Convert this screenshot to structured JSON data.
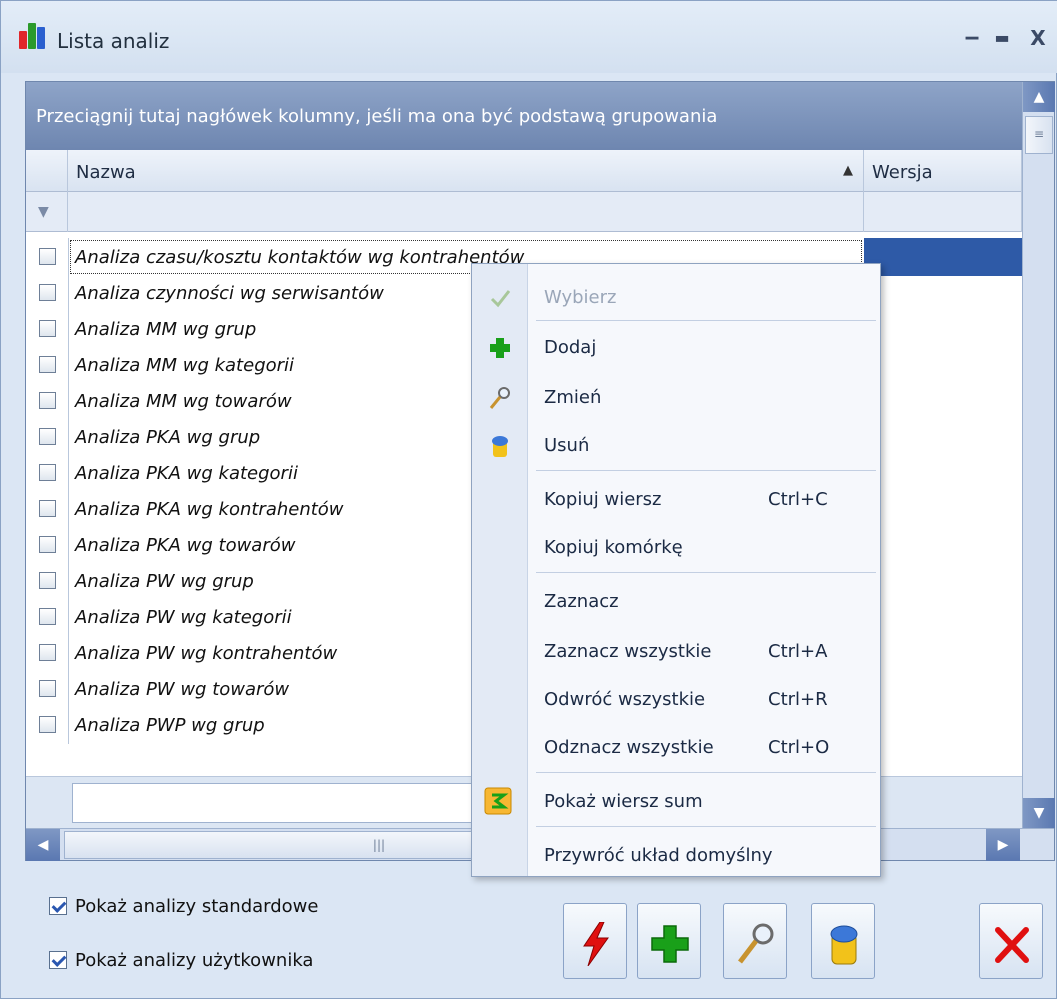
{
  "window": {
    "title": "Lista analiz",
    "min_label": "‒",
    "max_label": "▬",
    "close_label": "X"
  },
  "grid": {
    "group_panel_text": "Przeciągnij tutaj nagłówek kolumny, jeśli ma ona być podstawą grupowania",
    "columns": {
      "name": "Nazwa",
      "version": "Wersja"
    },
    "sort_indicator": "▲",
    "rows": [
      "Analiza czasu/kosztu kontaktów wg kontrahentów",
      "Analiza czynności wg serwisantów",
      "Analiza MM wg grup",
      "Analiza MM wg kategorii",
      "Analiza MM wg towarów",
      "Analiza PKA wg grup",
      "Analiza PKA wg kategorii",
      "Analiza PKA wg kontrahentów",
      "Analiza PKA wg towarów",
      "Analiza PW wg grup",
      "Analiza PW wg kategorii",
      "Analiza PW wg kontrahentów",
      "Analiza PW wg towarów",
      "Analiza PWP wg grup"
    ],
    "selected_row": 0
  },
  "context_menu": {
    "items": [
      {
        "label": "Wybierz",
        "shortcut": "",
        "icon": "check-icon",
        "disabled": true
      },
      {
        "label": "Dodaj",
        "shortcut": "",
        "icon": "plus-icon",
        "disabled": false
      },
      {
        "label": "Zmień",
        "shortcut": "",
        "icon": "magnifier-icon",
        "disabled": false
      },
      {
        "label": "Usuń",
        "shortcut": "",
        "icon": "trash-icon",
        "disabled": false
      },
      {
        "label": "Kopiuj wiersz",
        "shortcut": "Ctrl+C",
        "icon": "",
        "disabled": false
      },
      {
        "label": "Kopiuj komórkę",
        "shortcut": "",
        "icon": "",
        "disabled": false
      },
      {
        "label": "Zaznacz",
        "shortcut": "",
        "icon": "",
        "disabled": false
      },
      {
        "label": "Zaznacz wszystkie",
        "shortcut": "Ctrl+A",
        "icon": "",
        "disabled": false
      },
      {
        "label": "Odwróć wszystkie",
        "shortcut": "Ctrl+R",
        "icon": "",
        "disabled": false
      },
      {
        "label": "Odznacz wszystkie",
        "shortcut": "Ctrl+O",
        "icon": "",
        "disabled": false
      },
      {
        "label": "Pokaż wiersz sum",
        "shortcut": "",
        "icon": "sum-icon",
        "disabled": false
      },
      {
        "label": "Przywróć układ domyślny",
        "shortcut": "",
        "icon": "",
        "disabled": false
      }
    ]
  },
  "options": {
    "show_standard": "Pokaż analizy standardowe",
    "show_user": "Pokaż analizy użytkownika"
  },
  "toolbar": {
    "run_icon": "lightning-icon",
    "add_icon": "plus-icon",
    "edit_icon": "magnifier-icon",
    "delete_icon": "trash-icon",
    "close_icon": "red-x-icon"
  },
  "colors": {
    "selection": "#2e5aa7",
    "group_panel": "#7d94bd",
    "accent_green": "#19a019",
    "accent_red": "#e01010"
  }
}
